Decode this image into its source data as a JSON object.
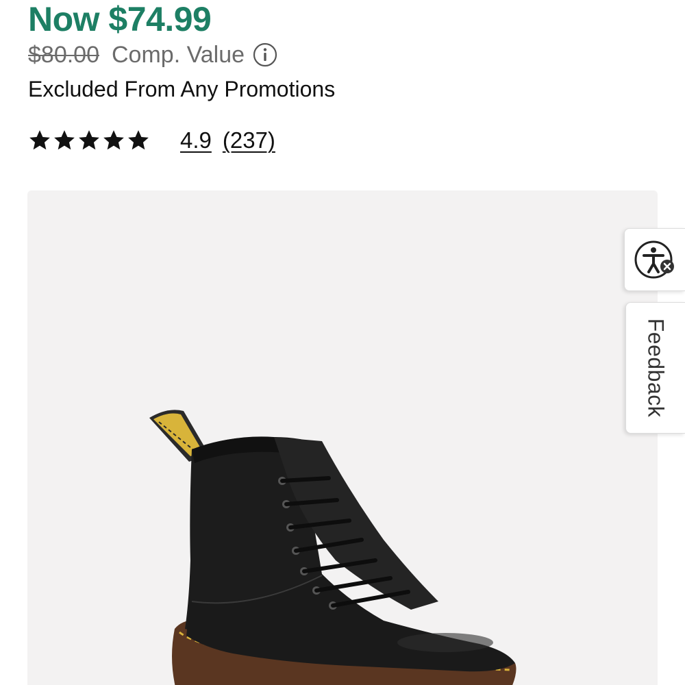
{
  "price": {
    "now": "Now $74.99",
    "was": "$80.00",
    "comp_label": "Comp. Value"
  },
  "promo_text": "Excluded From Any Promotions",
  "rating": {
    "stars": 5,
    "value": "4.9",
    "count": "(237)"
  },
  "product_image": {
    "icon": "boot-image"
  },
  "side_tabs": {
    "accessibility_icon": "accessibility-icon",
    "feedback_label": "Feedback"
  },
  "colors": {
    "price_green": "#1d7f64",
    "muted_gray": "#6b6b6b",
    "panel_bg": "#f3f2f2"
  }
}
